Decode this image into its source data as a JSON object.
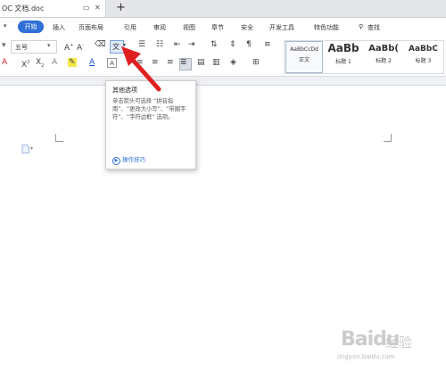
{
  "tabs": {
    "doc_title": "OC 文档.doc",
    "new_tab": "+"
  },
  "menu": {
    "active": "开始",
    "items": [
      "插入",
      "页面布局",
      "引用",
      "审阅",
      "视图",
      "章节",
      "安全",
      "开发工具",
      "特色功能"
    ],
    "search": "查找"
  },
  "ribbon": {
    "font_size": "五号",
    "phonetic_glyph": "文",
    "styles": [
      {
        "sample": "AaBbCcDd",
        "name": "正文"
      },
      {
        "sample": "AaBb",
        "name": "标题 1"
      },
      {
        "sample": "AaBb(",
        "name": "标题 2"
      },
      {
        "sample": "AaBbC",
        "name": "标题 3"
      }
    ]
  },
  "tooltip": {
    "title": "其他选项",
    "body": "单击箭头可选择 “拼音指南”、“更改大小写”、“带圈字符”、“字符边框” 选项。",
    "link": "操作技巧"
  },
  "watermark": {
    "brand": "Baidu",
    "cn": "经验",
    "url": "jingyan.baidu.com"
  },
  "colors": {
    "accent": "#2f6fd6",
    "arrow": "#e02020"
  }
}
